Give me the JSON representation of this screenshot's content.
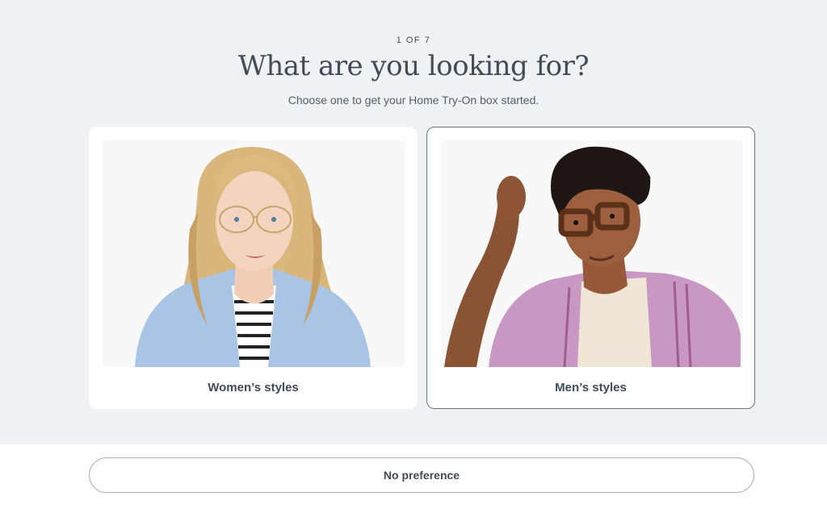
{
  "progress": {
    "step_label": "1 OF 7",
    "current": 1,
    "total": 7
  },
  "header": {
    "title": "What are you looking for?",
    "subtitle": "Choose one to get your Home Try-On box started."
  },
  "options": [
    {
      "label": "Women’s styles",
      "selected": false,
      "photo": "woman-in-gold-frame-glasses"
    },
    {
      "label": "Men’s styles",
      "selected": true,
      "photo": "man-in-tortoise-frame-glasses"
    }
  ],
  "footer": {
    "no_preference_label": "No preference"
  },
  "colors": {
    "background": "#eff2f5",
    "card": "#ffffff",
    "text": "#414b56",
    "selected_border": "#6a737c"
  }
}
